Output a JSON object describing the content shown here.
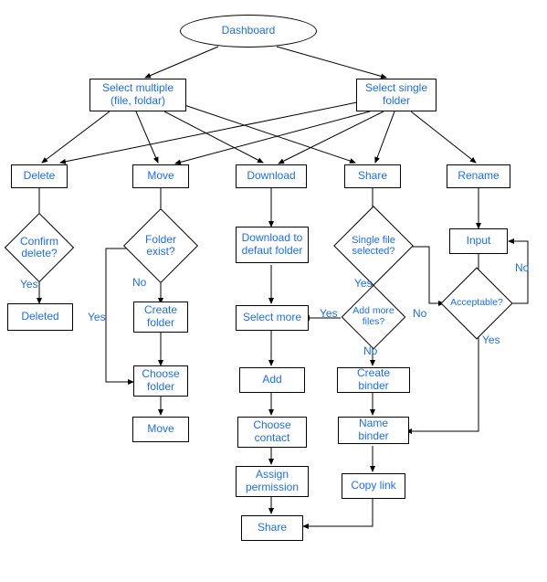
{
  "title": "Dashboard",
  "nodes": {
    "dashboard": "Dashboard",
    "select_multiple": "Select multiple (file, foldar)",
    "select_single": "Select single folder",
    "delete": "Delete",
    "move": "Move",
    "download": "Download",
    "share": "Share",
    "rename": "Rename",
    "confirm_delete": "Confirm delete?",
    "folder_exist": "Folder exist?",
    "download_defaut": "Download to defaut folder",
    "single_file_selected": "Single file selected?",
    "input": "Input",
    "acceptable": "Acceptable?",
    "deleted": "Deleted",
    "create_folder": "Create folder",
    "select_more": "Select more",
    "add_more_files": "Add more files?",
    "choose_folder": "Choose folder",
    "add": "Add",
    "create_binder": "Create binder",
    "move2": "Move",
    "choose_contact": "Choose contact",
    "name_binder": "Name binder",
    "assign_permission": "Assign permission",
    "copy_link": "Copy link",
    "share2": "Share"
  },
  "labels": {
    "yes": "Yes",
    "no": "No"
  }
}
